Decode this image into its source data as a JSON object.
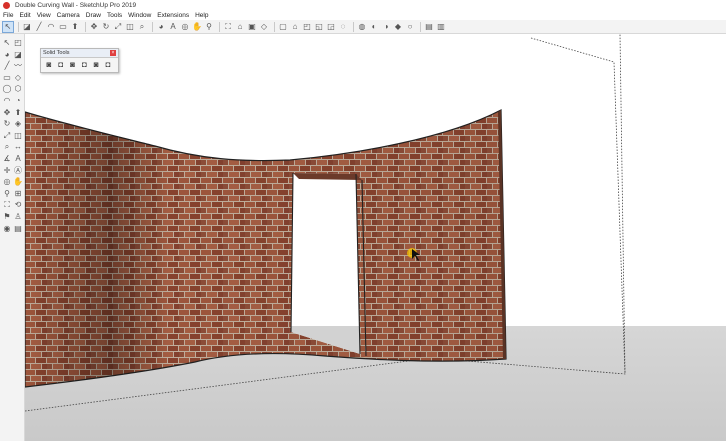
{
  "window": {
    "title": "Double Curving Wall - SketchUp Pro 2019",
    "accent": "#d6302a"
  },
  "menu": [
    "File",
    "Edit",
    "View",
    "Camera",
    "Draw",
    "Tools",
    "Window",
    "Extensions",
    "Help"
  ],
  "toolbar": {
    "icons": [
      {
        "name": "select-icon",
        "glyph": "↖"
      },
      {
        "name": "eraser-icon",
        "glyph": "◪"
      },
      {
        "name": "line-icon",
        "glyph": "╱"
      },
      {
        "name": "arc-icon",
        "glyph": "◠"
      },
      {
        "name": "shape-icon",
        "glyph": "▭"
      },
      {
        "name": "push-pull-icon",
        "glyph": "⬆"
      },
      {
        "name": "move-icon",
        "glyph": "✥"
      },
      {
        "name": "rotate-icon",
        "glyph": "↻"
      },
      {
        "name": "scale-icon",
        "glyph": "⤢"
      },
      {
        "name": "offset-icon",
        "glyph": "◫"
      },
      {
        "name": "tape-measure-icon",
        "glyph": "⌕"
      },
      {
        "name": "paint-bucket-icon",
        "glyph": "◕"
      },
      {
        "name": "text-icon",
        "glyph": "A"
      },
      {
        "name": "orbit-icon",
        "glyph": "◎"
      },
      {
        "name": "pan-icon",
        "glyph": "✋"
      },
      {
        "name": "zoom-icon",
        "glyph": "⚲"
      },
      {
        "name": "zoom-extents-icon",
        "glyph": "⛶"
      },
      {
        "name": "warehouse-icon",
        "glyph": "⌂"
      },
      {
        "name": "extension-icon",
        "glyph": "▣"
      },
      {
        "name": "iso-view-icon",
        "glyph": "◇"
      },
      {
        "name": "top-view-icon",
        "glyph": "▢"
      },
      {
        "name": "front-view-icon",
        "glyph": "⌂"
      },
      {
        "name": "right-view-icon",
        "glyph": "◰"
      },
      {
        "name": "back-view-icon",
        "glyph": "◱"
      },
      {
        "name": "left-view-icon",
        "glyph": "◲"
      },
      {
        "name": "xray-icon",
        "glyph": "◌"
      },
      {
        "name": "wireframe-icon",
        "glyph": "◍"
      },
      {
        "name": "hidden-line-icon",
        "glyph": "◐"
      },
      {
        "name": "shaded-icon",
        "glyph": "◑"
      },
      {
        "name": "shaded-texture-icon",
        "glyph": "◆"
      },
      {
        "name": "monochrome-icon",
        "glyph": "○"
      },
      {
        "name": "section-plane-icon",
        "glyph": "▤"
      },
      {
        "name": "section-display-icon",
        "glyph": "▥"
      }
    ],
    "separators_after": [
      0,
      5,
      10,
      15,
      19,
      25,
      30
    ]
  },
  "left_toolbar": {
    "icons": [
      "select-icon",
      "component-icon",
      "paint-icon",
      "eraser-icon",
      "line-icon",
      "freehand-icon",
      "rectangle-icon",
      "rotated-rect-icon",
      "circle-icon",
      "polygon-icon",
      "arc-icon",
      "pie-icon",
      "move-icon",
      "push-pull-icon",
      "rotate-icon",
      "follow-me-icon",
      "scale-icon",
      "offset-icon",
      "tape-icon",
      "dimension-icon",
      "protractor-icon",
      "text-icon",
      "axes-icon",
      "3d-text-icon",
      "orbit-icon",
      "pan-icon",
      "zoom-icon",
      "zoom-window-icon",
      "zoom-extents-icon",
      "previous-view-icon",
      "position-camera-icon",
      "walk-icon",
      "look-around-icon",
      "section-plane-icon"
    ],
    "glyphs": [
      "↖",
      "◰",
      "◕",
      "◪",
      "╱",
      "〰",
      "▭",
      "◇",
      "◯",
      "⬡",
      "◠",
      "◔",
      "✥",
      "⬆",
      "↻",
      "◈",
      "⤢",
      "◫",
      "⌕",
      "↔",
      "∡",
      "A",
      "✛",
      "Ⓐ",
      "◎",
      "✋",
      "⚲",
      "⊞",
      "⛶",
      "⟲",
      "⚑",
      "♙",
      "◉",
      "▤"
    ]
  },
  "solid_tools": {
    "title": "Solid Tools",
    "close": "×",
    "icons": [
      {
        "name": "outer-shell-icon",
        "glyph": "◙"
      },
      {
        "name": "intersect-icon",
        "glyph": "◘"
      },
      {
        "name": "union-icon",
        "glyph": "◙"
      },
      {
        "name": "subtract-icon",
        "glyph": "◘"
      },
      {
        "name": "trim-icon",
        "glyph": "◙"
      },
      {
        "name": "split-icon",
        "glyph": "◘"
      }
    ]
  },
  "scene": {
    "sky": "#ffffff",
    "ground": "#d3d3d3",
    "brick": "#9a4f37",
    "mortar": "#c9b6a3",
    "edge": "#222222"
  }
}
